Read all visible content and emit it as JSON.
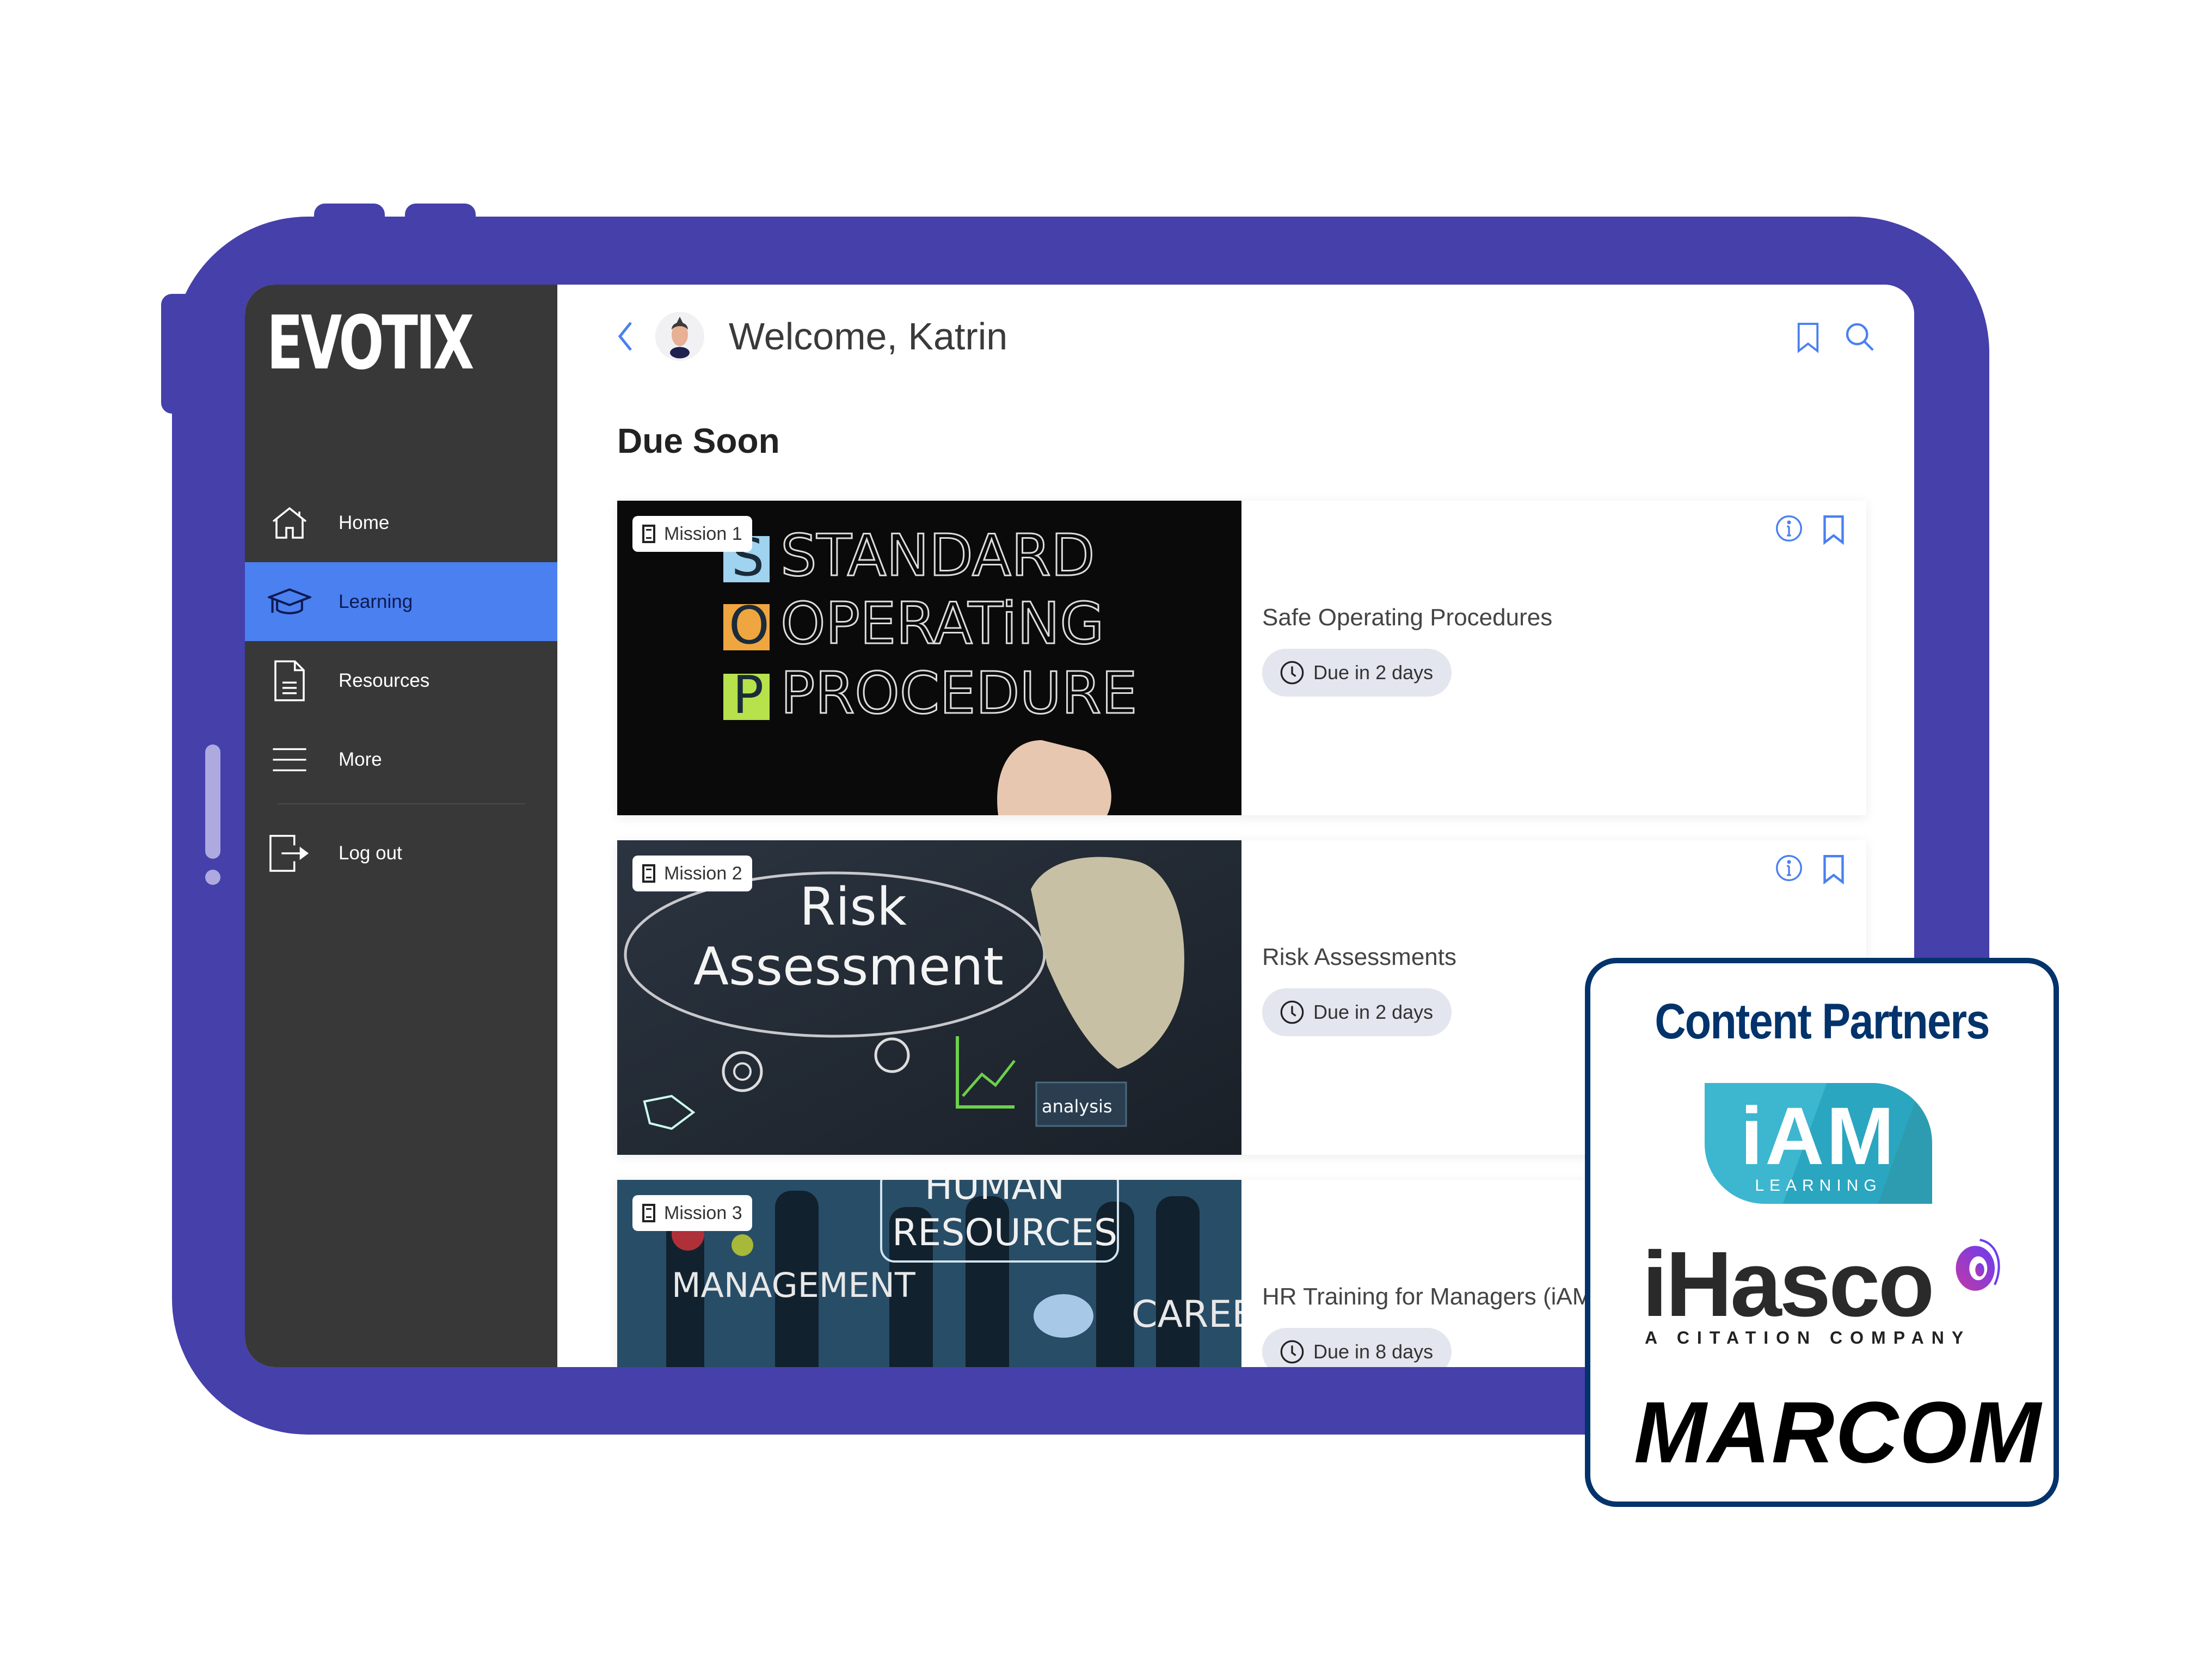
{
  "app": {
    "brand": "EVOTIX",
    "accent_color": "#4a80f0",
    "device_color": "#4540aa"
  },
  "sidebar": {
    "items": [
      {
        "label": "Home",
        "icon": "home-icon",
        "active": false
      },
      {
        "label": "Learning",
        "icon": "graduation-cap-icon",
        "active": true
      },
      {
        "label": "Resources",
        "icon": "document-icon",
        "active": false
      },
      {
        "label": "More",
        "icon": "menu-icon",
        "active": false
      }
    ],
    "logout": {
      "label": "Log out",
      "icon": "logout-icon"
    }
  },
  "header": {
    "welcome": "Welcome, Katrin",
    "icons": [
      "back-chevron-icon",
      "avatar",
      "bookmark-icon",
      "search-icon"
    ]
  },
  "main": {
    "section_title": "Due Soon",
    "cards": [
      {
        "mission": "Mission 1",
        "title": "Safe Operating Procedures",
        "due": "Due in 2 days",
        "image_text": [
          "STANDARD",
          "OPERATiNG",
          "PROCEDURE"
        ]
      },
      {
        "mission": "Mission 2",
        "title": "Risk Assessments",
        "due": "Due in 2 days",
        "image_text": [
          "Risk",
          "Assessment",
          "analysis"
        ]
      },
      {
        "mission": "Mission 3",
        "title": "HR Training for Managers (iAM",
        "due": "Due in 8 days",
        "image_text": [
          "HUMAN",
          "RESOURCES",
          "MANAGEMENT",
          "CAREER"
        ]
      }
    ]
  },
  "partners": {
    "title": "Content Partners",
    "iam": {
      "name": "iAM",
      "sub": "LEARNING"
    },
    "ihasco": {
      "name": "iHasco",
      "sub": "A CITATION COMPANY"
    },
    "marcom": {
      "name": "MARCOM"
    }
  }
}
